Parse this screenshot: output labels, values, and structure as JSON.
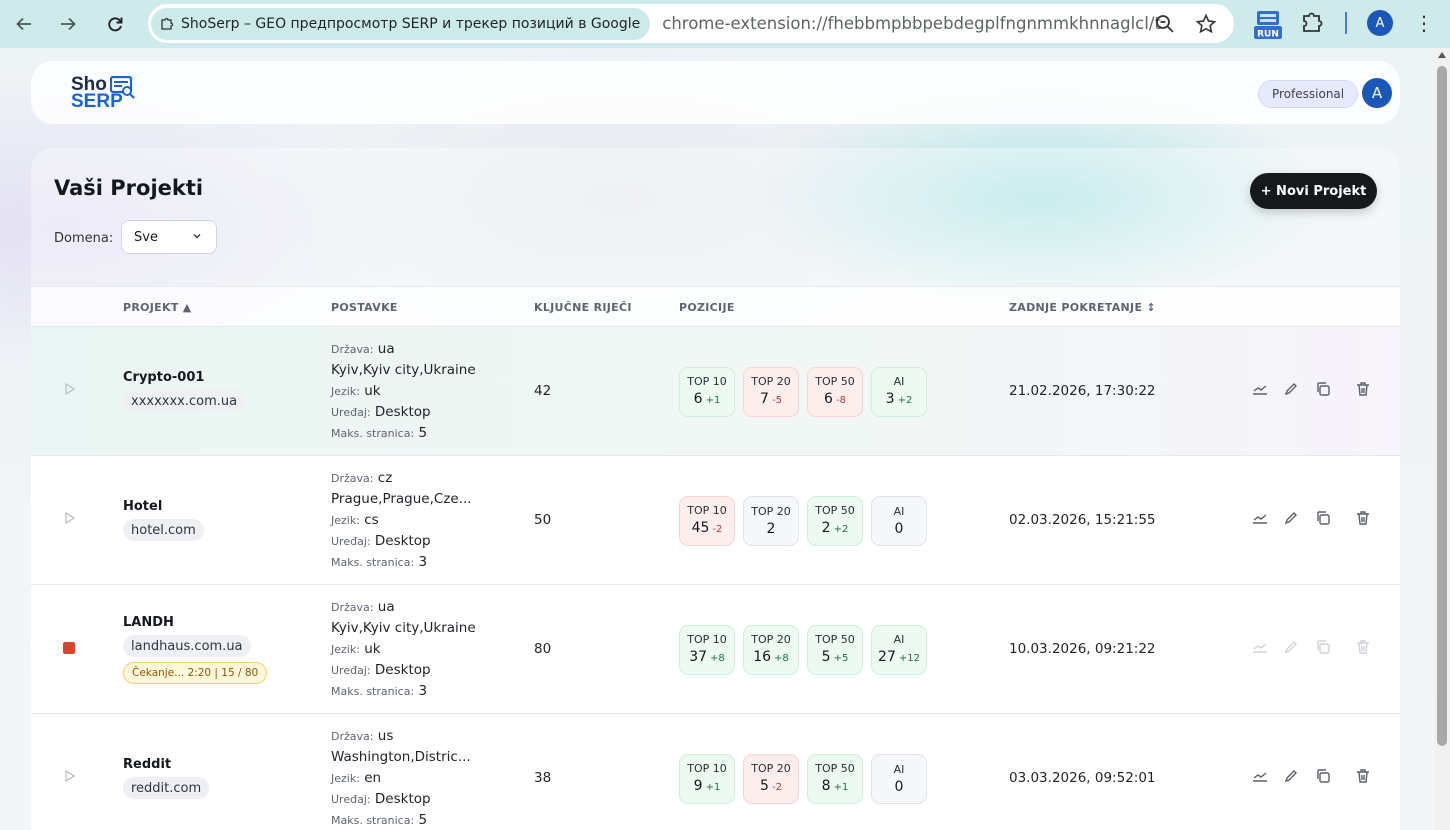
{
  "browser": {
    "tab_title": "ShoSerp – GEO предпросмотр SERP и трекер позиций в Google",
    "url": "chrome-extension://fhebbmpbbpebdegplfngnmmkhnnaglcl/tr...",
    "ext_run_label": "RUN",
    "profile_initial": "A"
  },
  "header": {
    "logo_top": "Sho",
    "logo_bottom": "SERP",
    "plan": "Professional",
    "avatar": "A"
  },
  "projects": {
    "title": "Vaši Projekti",
    "new_button": "+ Novi Projekt",
    "filter_label": "Domena:",
    "filter_value": "Sve",
    "columns": {
      "project": "PROJEKT ▲",
      "settings": "POSTAVKE",
      "keywords": "KLJUČNE RIJEČI",
      "positions": "POZICIJE",
      "last_run": "ZADNJE POKRETANJE ↕"
    },
    "settings_labels": {
      "country": "Država:",
      "language": "Jezik:",
      "device": "Uređaj:",
      "max_pages": "Maks. stranica:"
    },
    "rows": [
      {
        "name": "Crypto-001",
        "domain": "xxxxxxx.com.ua",
        "status": "idle",
        "wait": "",
        "country": "ua",
        "location": "Kyiv,Kyiv city,Ukraine",
        "language": "uk",
        "device": "Desktop",
        "max_pages": "5",
        "keywords": "42",
        "positions": [
          {
            "label": "TOP 10",
            "value": "6",
            "delta": "+1",
            "tone": "green"
          },
          {
            "label": "TOP 20",
            "value": "7",
            "delta": "-5",
            "tone": "red"
          },
          {
            "label": "TOP 50",
            "value": "6",
            "delta": "-8",
            "tone": "red"
          },
          {
            "label": "AI",
            "value": "3",
            "delta": "+2",
            "tone": "green"
          }
        ],
        "last_run": "21.02.2026, 17:30:22",
        "actions_enabled": true
      },
      {
        "name": "Hotel",
        "domain": "hotel.com",
        "status": "idle",
        "wait": "",
        "country": "cz",
        "location": "Prague,Prague,Cze...",
        "language": "cs",
        "device": "Desktop",
        "max_pages": "3",
        "keywords": "50",
        "positions": [
          {
            "label": "TOP 10",
            "value": "45",
            "delta": "-2",
            "tone": "red"
          },
          {
            "label": "TOP 20",
            "value": "2",
            "delta": "",
            "tone": "neutral"
          },
          {
            "label": "TOP 50",
            "value": "2",
            "delta": "+2",
            "tone": "green"
          },
          {
            "label": "AI",
            "value": "0",
            "delta": "",
            "tone": "neutral"
          }
        ],
        "last_run": "02.03.2026, 15:21:55",
        "actions_enabled": true
      },
      {
        "name": "LANDH",
        "domain": "landhaus.com.ua",
        "status": "running",
        "wait": "Čekanje... 2:20  |  15 / 80",
        "country": "ua",
        "location": "Kyiv,Kyiv city,Ukraine",
        "language": "uk",
        "device": "Desktop",
        "max_pages": "3",
        "keywords": "80",
        "positions": [
          {
            "label": "TOP 10",
            "value": "37",
            "delta": "+8",
            "tone": "green"
          },
          {
            "label": "TOP 20",
            "value": "16",
            "delta": "+8",
            "tone": "green"
          },
          {
            "label": "TOP 50",
            "value": "5",
            "delta": "+5",
            "tone": "green"
          },
          {
            "label": "AI",
            "value": "27",
            "delta": "+12",
            "tone": "green"
          }
        ],
        "last_run": "10.03.2026, 09:21:22",
        "actions_enabled": false
      },
      {
        "name": "Reddit",
        "domain": "reddit.com",
        "status": "idle",
        "wait": "",
        "country": "us",
        "location": "Washington,Distric...",
        "language": "en",
        "device": "Desktop",
        "max_pages": "5",
        "keywords": "38",
        "positions": [
          {
            "label": "TOP 10",
            "value": "9",
            "delta": "+1",
            "tone": "green"
          },
          {
            "label": "TOP 20",
            "value": "5",
            "delta": "-2",
            "tone": "red"
          },
          {
            "label": "TOP 50",
            "value": "8",
            "delta": "+1",
            "tone": "green"
          },
          {
            "label": "AI",
            "value": "0",
            "delta": "",
            "tone": "neutral"
          }
        ],
        "last_run": "03.03.2026, 09:52:01",
        "actions_enabled": true
      }
    ]
  }
}
